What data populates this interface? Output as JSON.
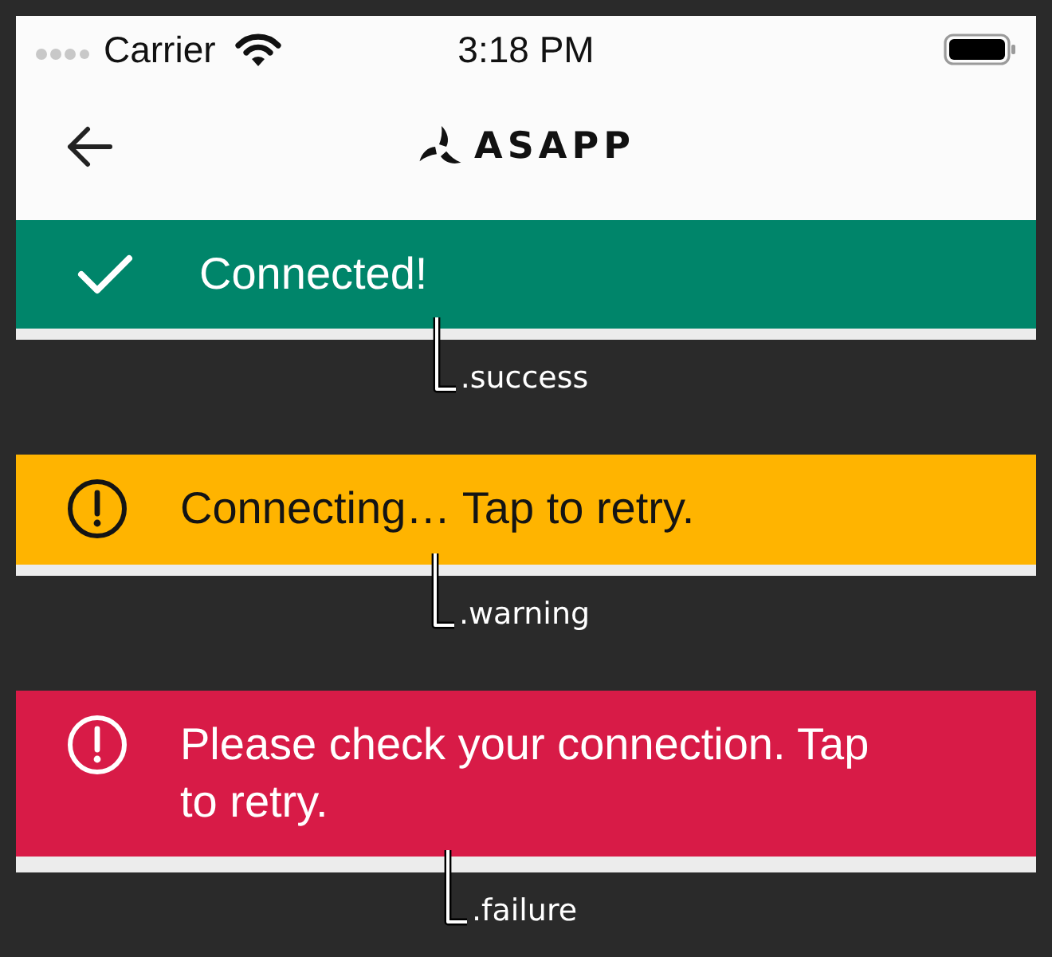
{
  "status_bar": {
    "carrier": "Carrier",
    "time": "3:18 PM"
  },
  "nav_bar": {
    "brand": "ASAPP"
  },
  "banners": [
    {
      "kind": "success",
      "color": "#00856a",
      "message": "Connected!",
      "caption": ".success"
    },
    {
      "kind": "warning",
      "color": "#ffb400",
      "message": "Connecting… Tap to retry.",
      "caption": ".warning"
    },
    {
      "kind": "failure",
      "color": "#d81b47",
      "message": "Please check your connection. Tap to retry.",
      "caption": ".failure"
    }
  ]
}
